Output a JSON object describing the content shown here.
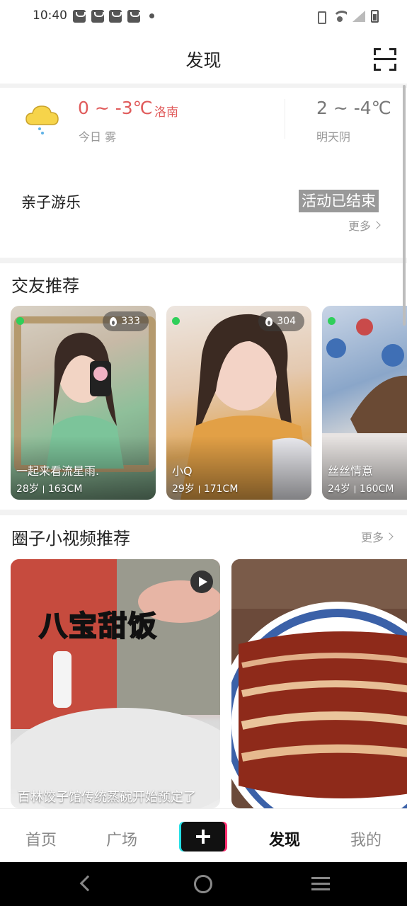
{
  "status_bar": {
    "time": "10:40"
  },
  "header": {
    "title": "发现"
  },
  "weather": {
    "today_temp": "0 ~ -3℃",
    "city": "洛南",
    "today_desc": "今日 雾",
    "tomorrow_temp": "2 ~ -4℃",
    "tomorrow_desc": "明天阴"
  },
  "activity": {
    "label": "亲子游乐",
    "status": "活动已结束",
    "more": "更多"
  },
  "friends": {
    "title": "交友推荐",
    "cards": [
      {
        "name": "一起来看流星雨.",
        "age": "28岁",
        "height": "163CM",
        "heat": "333"
      },
      {
        "name": "小Q",
        "age": "29岁",
        "height": "171CM",
        "heat": "304"
      },
      {
        "name": "丝丝情意",
        "age": "24岁",
        "height": "160CM"
      }
    ]
  },
  "videos": {
    "title": "圈子小视频推荐",
    "more": "更多",
    "cards": [
      {
        "headline": "八宝甜饭",
        "caption": "百林饺子馆传统蒸碗开始预定了"
      },
      {
        "caption": ""
      }
    ]
  },
  "bottom_nav": {
    "home": "首页",
    "plaza": "广场",
    "discover": "发现",
    "mine": "我的"
  },
  "colors": {
    "accent_red": "#e05a5a",
    "online_green": "#2fcf5a"
  }
}
